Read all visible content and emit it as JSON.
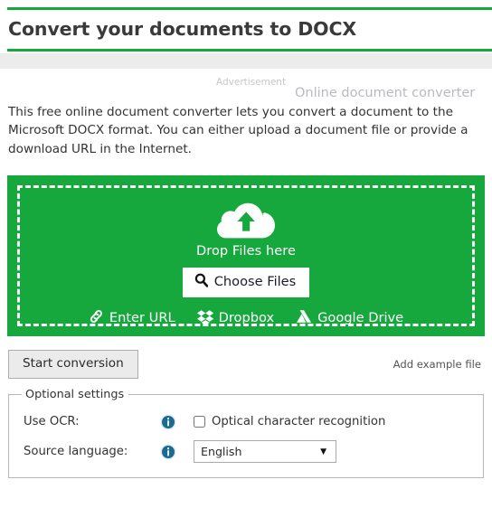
{
  "header": {
    "title": "Convert your documents to DOCX"
  },
  "advertisement": {
    "label": "Advertisement",
    "text": "Online document converter"
  },
  "description": "This free online document converter lets you convert a document to the Microsoft DOCX format. You can either upload a document file or provide a download URL in the Internet.",
  "dropzone": {
    "drop_label": "Drop Files here",
    "choose_files_label": "Choose Files",
    "choose_files_icon": "search-icon",
    "cloud_icon": "cloud-upload-icon",
    "sources": [
      {
        "label": "Enter URL",
        "icon": "link-icon"
      },
      {
        "label": "Dropbox",
        "icon": "dropbox-icon"
      },
      {
        "label": "Google Drive",
        "icon": "google-drive-icon"
      }
    ]
  },
  "actions": {
    "start_label": "Start conversion",
    "example_link_label": "Add example file"
  },
  "settings": {
    "legend": "Optional settings",
    "ocr": {
      "label": "Use OCR:",
      "info_icon": "info-icon",
      "checkbox_label": "Optical character recognition",
      "checked": false
    },
    "language": {
      "label": "Source language:",
      "info_icon": "info-icon",
      "selected": "English",
      "options": [
        "English"
      ]
    }
  },
  "colors": {
    "brand_green": "#16a83c",
    "gray_bar": "#ececec",
    "info_blue": "#1a6a96"
  }
}
